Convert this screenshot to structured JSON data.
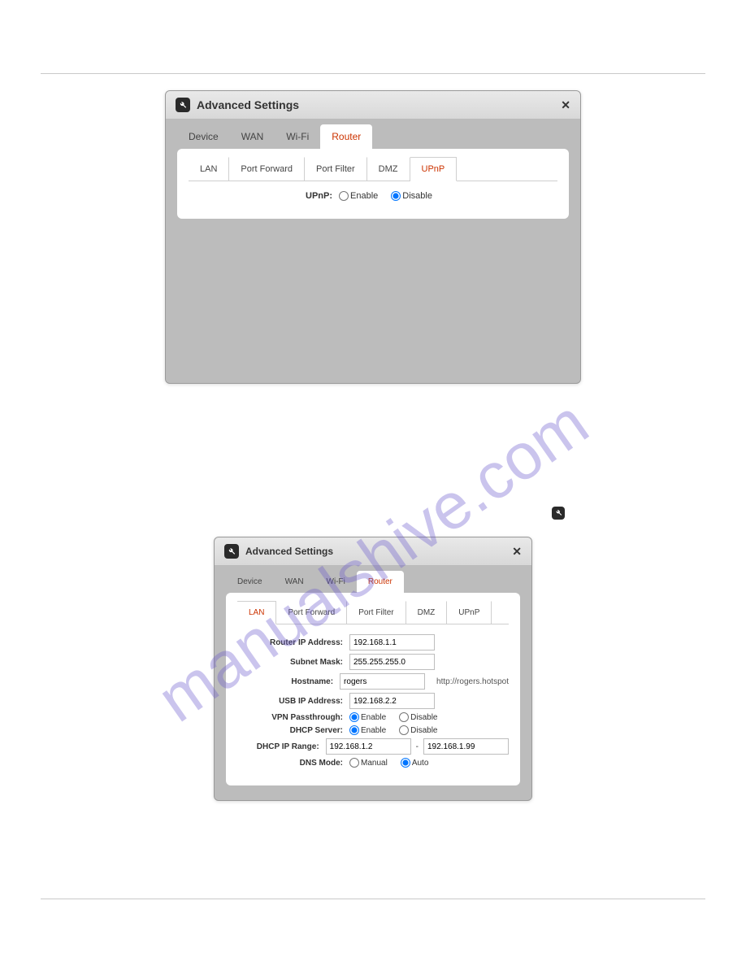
{
  "watermark": "manualshive.com",
  "window1": {
    "title": "Advanced Settings",
    "tabs": [
      "Device",
      "WAN",
      "Wi-Fi",
      "Router"
    ],
    "activeTab": "Router",
    "subtabs": [
      "LAN",
      "Port Forward",
      "Port Filter",
      "DMZ",
      "UPnP"
    ],
    "activeSubtab": "UPnP",
    "upnp": {
      "label": "UPnP:",
      "opt1": "Enable",
      "opt2": "Disable",
      "selected": "Disable"
    }
  },
  "inlineIcon": "wrench-icon",
  "window2": {
    "title": "Advanced Settings",
    "tabs": [
      "Device",
      "WAN",
      "Wi-Fi",
      "Router"
    ],
    "activeTab": "Router",
    "subtabs": [
      "LAN",
      "Port Forward",
      "Port Filter",
      "DMZ",
      "UPnP"
    ],
    "activeSubtab": "LAN",
    "fields": {
      "routerIp": {
        "label": "Router IP Address:",
        "value": "192.168.1.1"
      },
      "subnet": {
        "label": "Subnet Mask:",
        "value": "255.255.255.0"
      },
      "hostname": {
        "label": "Hostname:",
        "value": "rogers",
        "suffix": "http://rogers.hotspot"
      },
      "usbIp": {
        "label": "USB IP Address:",
        "value": "192.168.2.2"
      },
      "vpn": {
        "label": "VPN Passthrough:",
        "opt1": "Enable",
        "opt2": "Disable",
        "selected": "Enable"
      },
      "dhcpServer": {
        "label": "DHCP Server:",
        "opt1": "Enable",
        "opt2": "Disable",
        "selected": "Enable"
      },
      "dhcpRange": {
        "label": "DHCP IP Range:",
        "from": "192.168.1.2",
        "sep": "-",
        "to": "192.168.1.99"
      },
      "dnsMode": {
        "label": "DNS Mode:",
        "opt1": "Manual",
        "opt2": "Auto",
        "selected": "Auto"
      }
    }
  }
}
